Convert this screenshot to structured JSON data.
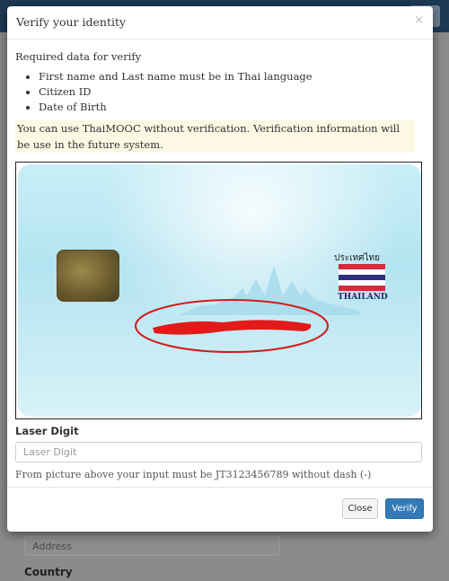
{
  "background": {
    "address_placeholder": "Address",
    "country_label": "Country"
  },
  "modal": {
    "title": "Verify your identity",
    "close_symbol": "×",
    "required_title": "Required data for verify",
    "requirements": [
      "First name and Last name must be in Thai language",
      "Citizen ID",
      "Date of Birth"
    ],
    "notice": "You can use ThaiMOOC without verification. Verification information will be use in the future system.",
    "card": {
      "country_thai": "ประเทศไทย",
      "country_en": "THAILAND",
      "flag_colors": [
        "#d52b3b",
        "#ffffff",
        "#2b2f7e",
        "#ffffff",
        "#d52b3b"
      ],
      "highlight_color": "#d41a1a"
    },
    "laser_label": "Laser Digit",
    "laser_placeholder": "Laser Digit",
    "help_text": "From picture above your input must be JT3123456789 without dash (-)",
    "buttons": {
      "close": "Close",
      "verify": "Verify"
    }
  }
}
